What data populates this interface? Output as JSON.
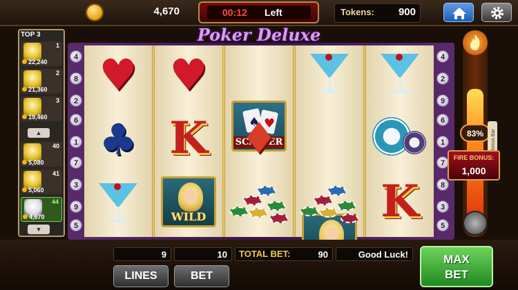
{
  "header": {
    "coins": "4,670",
    "timer_time": "00:12",
    "timer_label": "Left",
    "tokens_label": "Tokens:",
    "tokens_value": "900",
    "home_icon": "home-icon",
    "settings_icon": "gear-icon"
  },
  "game": {
    "title": "Poker Deluxe"
  },
  "leaderboard": {
    "title": "TOP 3",
    "top": [
      {
        "rank": "1",
        "score": "22,240"
      },
      {
        "rank": "2",
        "score": "21,360"
      },
      {
        "rank": "3",
        "score": "19,460"
      }
    ],
    "others": [
      {
        "rank": "40",
        "score": "5,080"
      },
      {
        "rank": "41",
        "score": "5,060"
      },
      {
        "rank": "44",
        "score": "4,670"
      }
    ],
    "scroll_up": "▲",
    "scroll_down": "▼"
  },
  "reels": {
    "left_lines": [
      "4",
      "8",
      "6",
      "7",
      "5"
    ],
    "left_lines_2": [
      "2",
      "3",
      "1",
      "9"
    ],
    "right_lines": [
      "4",
      "8",
      "9",
      "6",
      "7",
      "8",
      "5"
    ],
    "right_lines_2": [
      "2",
      "3",
      "1",
      "9"
    ],
    "symbols": [
      [
        "heart",
        "club",
        "martini"
      ],
      [
        "heart",
        "king",
        "wild"
      ],
      [
        "scatter",
        "diamond",
        "chips"
      ],
      [
        "martini",
        "wild",
        "chips"
      ],
      [
        "martini",
        "pokerchip",
        "king"
      ]
    ],
    "scatter_label": "SCATTER",
    "wild_label": "WILD",
    "king_letter": "K",
    "heart_glyph": "♥",
    "club_glyph": "♣",
    "diamond_glyph": "♦"
  },
  "fire_bonus": {
    "percent": "83%",
    "percent_value": 83,
    "label": "FIRE BONUS:",
    "value": "1,000",
    "tab_label": "Bonus Bar"
  },
  "controls": {
    "lines_value": "9",
    "bet_value": "10",
    "total_bet_label": "TOTAL BET:",
    "total_bet_value": "90",
    "message": "Good Luck!",
    "lines_button": "LINES",
    "bet_button": "BET",
    "max_bet_line1": "MAX",
    "max_bet_line2": "BET"
  },
  "colors": {
    "accent_gold": "#c8a035",
    "max_bet_green": "#1f8a23",
    "timer_red": "#ff4d3b"
  }
}
